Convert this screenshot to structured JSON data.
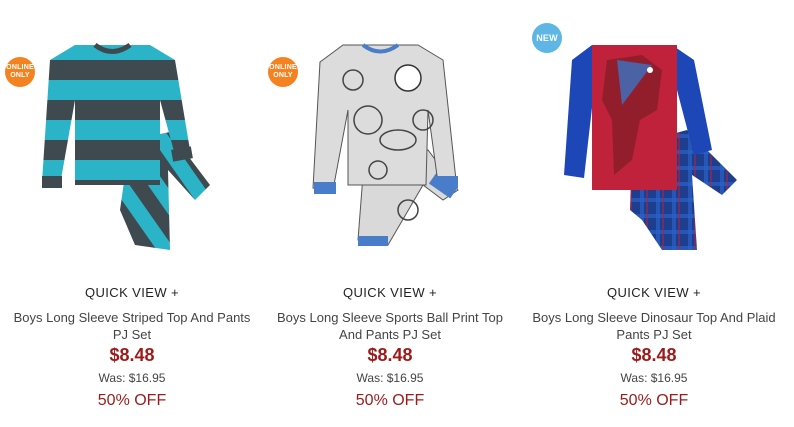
{
  "products": [
    {
      "badge_lines": [
        "ONLINE",
        "ONLY"
      ],
      "quick_view": "QUICK VIEW +",
      "name_line1": "Boys Long Sleeve Striped Top And Pants",
      "name_line2": "PJ Set",
      "price": "$8.48",
      "was": "Was: $16.95",
      "discount": "50% OFF",
      "image_icon": "striped-pajama-set-image"
    },
    {
      "badge_lines": [
        "ONLINE",
        "ONLY"
      ],
      "quick_view": "QUICK VIEW +",
      "name_line1": "Boys Long Sleeve Sports Ball Print Top",
      "name_line2": "And Pants PJ Set",
      "price": "$8.48",
      "was": "Was: $16.95",
      "discount": "50% OFF",
      "image_icon": "sports-ball-pajama-set-image"
    },
    {
      "badge_lines": [
        "NEW"
      ],
      "quick_view": "QUICK VIEW +",
      "name_line1": "Boys Long Sleeve Dinosaur Top And Plaid",
      "name_line2": "Pants PJ Set",
      "price": "$8.48",
      "was": "Was: $16.95",
      "discount": "50% OFF",
      "image_icon": "dinosaur-pajama-set-image"
    }
  ],
  "colors": {
    "price": "#9b1b1b",
    "online_badge": "#f58220",
    "new_badge": "#5eb6e4"
  }
}
